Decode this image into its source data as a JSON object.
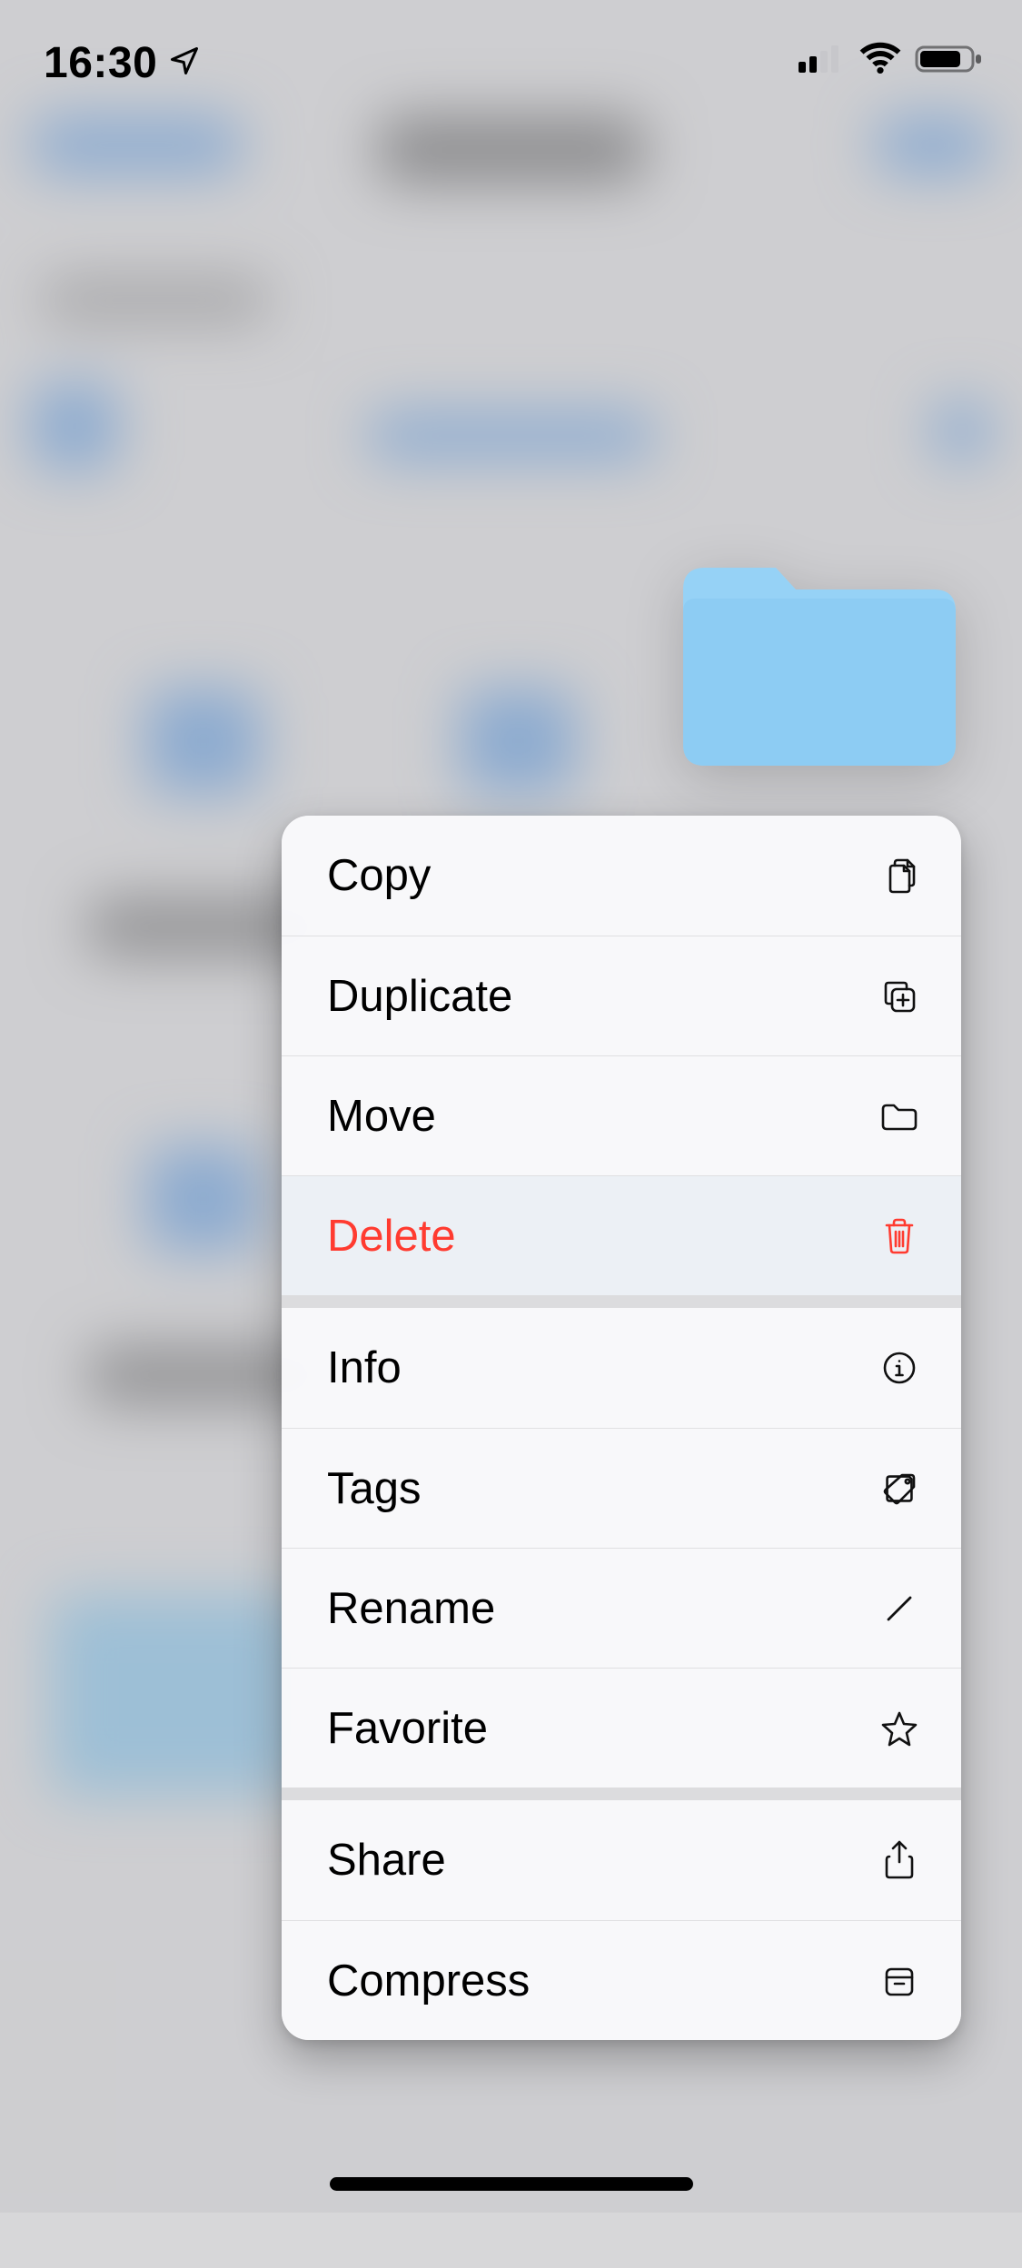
{
  "status_bar": {
    "time": "16:30",
    "location_icon": "location-arrow",
    "cellular_bars": 2,
    "wifi_icon": "wifi",
    "battery_icon": "battery-high"
  },
  "folder_preview": {
    "name": "Folder",
    "tint": "#8dccf3"
  },
  "menu": {
    "sections": [
      {
        "items": [
          {
            "label": "Copy",
            "icon": "copy-icon",
            "destructive": false
          },
          {
            "label": "Duplicate",
            "icon": "duplicate-icon",
            "destructive": false
          },
          {
            "label": "Move",
            "icon": "folder-icon",
            "destructive": false
          },
          {
            "label": "Delete",
            "icon": "trash-icon",
            "destructive": true
          }
        ]
      },
      {
        "items": [
          {
            "label": "Info",
            "icon": "info-icon",
            "destructive": false
          },
          {
            "label": "Tags",
            "icon": "tag-icon",
            "destructive": false
          },
          {
            "label": "Rename",
            "icon": "pencil-icon",
            "destructive": false
          },
          {
            "label": "Favorite",
            "icon": "star-icon",
            "destructive": false
          }
        ]
      },
      {
        "items": [
          {
            "label": "Share",
            "icon": "share-icon",
            "destructive": false
          },
          {
            "label": "Compress",
            "icon": "archive-icon",
            "destructive": false
          }
        ]
      }
    ]
  },
  "colors": {
    "destructive": "#ff3b30",
    "icon_stroke": "#111111"
  }
}
